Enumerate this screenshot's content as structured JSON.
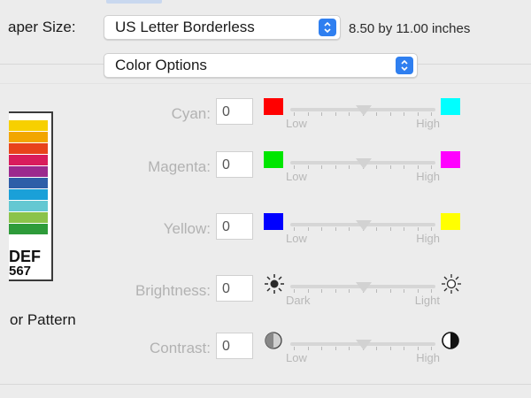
{
  "paper": {
    "label": "aper Size:",
    "value": "US Letter Borderless",
    "size_text": "8.50 by 11.00 inches"
  },
  "options_popup": {
    "value": "Color Options"
  },
  "thumbnail": {
    "line1": "DEF",
    "line2": "567",
    "caption": "or Pattern",
    "bands": [
      "#f7d000",
      "#f2a600",
      "#e8431b",
      "#d91c5c",
      "#9b2a8e",
      "#2e5ea8",
      "#1aa0d8",
      "#64c8d2",
      "#8bc34a",
      "#2e9b3a"
    ]
  },
  "controls": [
    {
      "name": "cyan",
      "label": "Cyan:",
      "value": "0",
      "left": {
        "type": "swatch",
        "color": "#ff0000"
      },
      "right": {
        "type": "swatch",
        "color": "#00ffff"
      },
      "low": "Low",
      "high": "High"
    },
    {
      "name": "magenta",
      "label": "Magenta:",
      "value": "0",
      "left": {
        "type": "swatch",
        "color": "#00e600"
      },
      "right": {
        "type": "swatch",
        "color": "#ff00ff"
      },
      "low": "Low",
      "high": "High"
    },
    {
      "name": "yellow",
      "label": "Yellow:",
      "value": "0",
      "left": {
        "type": "swatch",
        "color": "#0000ff"
      },
      "right": {
        "type": "swatch",
        "color": "#ffff00"
      },
      "low": "Low",
      "high": "High"
    },
    {
      "name": "brightness",
      "label": "Brightness:",
      "value": "0",
      "left": {
        "type": "icon",
        "icon": "sun-dark-icon"
      },
      "right": {
        "type": "icon",
        "icon": "sun-light-icon"
      },
      "low": "Dark",
      "high": "Light"
    },
    {
      "name": "contrast",
      "label": "Contrast:",
      "value": "0",
      "left": {
        "type": "icon",
        "icon": "contrast-low-icon"
      },
      "right": {
        "type": "icon",
        "icon": "contrast-high-icon"
      },
      "low": "Low",
      "high": "High"
    }
  ]
}
